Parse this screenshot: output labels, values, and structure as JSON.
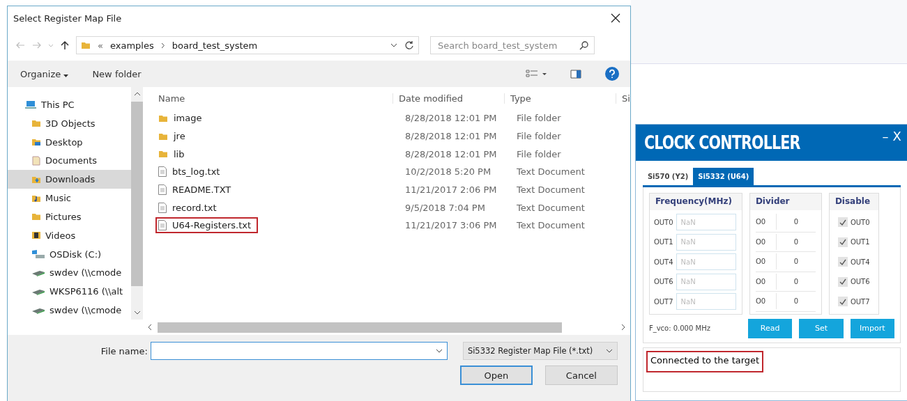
{
  "dialog": {
    "title": "Select Register Map File",
    "address": {
      "overflow": "«",
      "crumbs": [
        "examples",
        "board_test_system"
      ]
    },
    "search": {
      "placeholder": "Search board_test_system"
    },
    "toolbar": {
      "organize": "Organize",
      "new_folder": "New folder"
    },
    "nav": [
      {
        "label": "This PC",
        "kind": "pc",
        "selected": false
      },
      {
        "label": "3D Objects",
        "kind": "folder",
        "selected": false
      },
      {
        "label": "Desktop",
        "kind": "desktop",
        "selected": false
      },
      {
        "label": "Documents",
        "kind": "document",
        "selected": false
      },
      {
        "label": "Downloads",
        "kind": "download",
        "selected": true
      },
      {
        "label": "Music",
        "kind": "music",
        "selected": false
      },
      {
        "label": "Pictures",
        "kind": "folder",
        "selected": false
      },
      {
        "label": "Videos",
        "kind": "video",
        "selected": false
      },
      {
        "label": "OSDisk (C:)",
        "kind": "disk",
        "selected": false
      },
      {
        "label": "swdev (\\\\cmode",
        "kind": "network",
        "selected": false
      },
      {
        "label": "WKSP6116 (\\\\alt",
        "kind": "network",
        "selected": false
      },
      {
        "label": "swdev (\\\\cmode",
        "kind": "network",
        "selected": false
      }
    ],
    "columns": [
      "Name",
      "Date modified",
      "Type",
      "Si"
    ],
    "files": [
      {
        "name": "image",
        "date": "8/28/2018 12:01 PM",
        "type": "File folder",
        "kind": "folder",
        "marked": false
      },
      {
        "name": "jre",
        "date": "8/28/2018 12:01 PM",
        "type": "File folder",
        "kind": "folder",
        "marked": false
      },
      {
        "name": "lib",
        "date": "8/28/2018 12:01 PM",
        "type": "File folder",
        "kind": "folder",
        "marked": false
      },
      {
        "name": "bts_log.txt",
        "date": "10/2/2018 5:20 PM",
        "type": "Text Document",
        "kind": "file",
        "marked": false
      },
      {
        "name": "README.TXT",
        "date": "11/21/2017 2:06 PM",
        "type": "Text Document",
        "kind": "file",
        "marked": false
      },
      {
        "name": "record.txt",
        "date": "9/5/2018 7:04 PM",
        "type": "Text Document",
        "kind": "file",
        "marked": false
      },
      {
        "name": "U64-Registers.txt",
        "date": "11/21/2017 3:06 PM",
        "type": "Text Document",
        "kind": "file",
        "marked": true
      }
    ],
    "file_name_label": "File name:",
    "filter": "Si5332 Register Map File (*.txt)",
    "buttons": [
      "Open",
      "Cancel"
    ]
  },
  "clock": {
    "title": "CLOCK CONTROLLER",
    "minimize": "–",
    "close": "X",
    "tabs": [
      {
        "label": "Si570 (Y2)",
        "selected": false
      },
      {
        "label": "Si5332 (U64)",
        "selected": true
      }
    ],
    "frequency": {
      "heading": "Frequency(MHz)",
      "rows": [
        {
          "label": "OUT0",
          "placeholder": "NaN"
        },
        {
          "label": "OUT1",
          "placeholder": "NaN"
        },
        {
          "label": "OUT4",
          "placeholder": "NaN"
        },
        {
          "label": "OUT6",
          "placeholder": "NaN"
        },
        {
          "label": "OUT7",
          "placeholder": "NaN"
        }
      ]
    },
    "divider": {
      "heading": "Divider",
      "rows": [
        {
          "label": "O0",
          "value": "0"
        },
        {
          "label": "O0",
          "value": "0"
        },
        {
          "label": "O0",
          "value": "0"
        },
        {
          "label": "O0",
          "value": "0"
        },
        {
          "label": "O0",
          "value": "0"
        }
      ]
    },
    "disable": {
      "heading": "Disable",
      "rows": [
        {
          "label": "OUT0",
          "checked": true
        },
        {
          "label": "OUT1",
          "checked": true
        },
        {
          "label": "OUT4",
          "checked": true
        },
        {
          "label": "OUT6",
          "checked": true
        },
        {
          "label": "OUT7",
          "checked": true
        }
      ]
    },
    "fvco": "F_vco:  0.000 MHz",
    "buttons": [
      "Read",
      "Set",
      "Import"
    ],
    "status": {
      "text": "Connected to the target",
      "marked": true
    }
  }
}
